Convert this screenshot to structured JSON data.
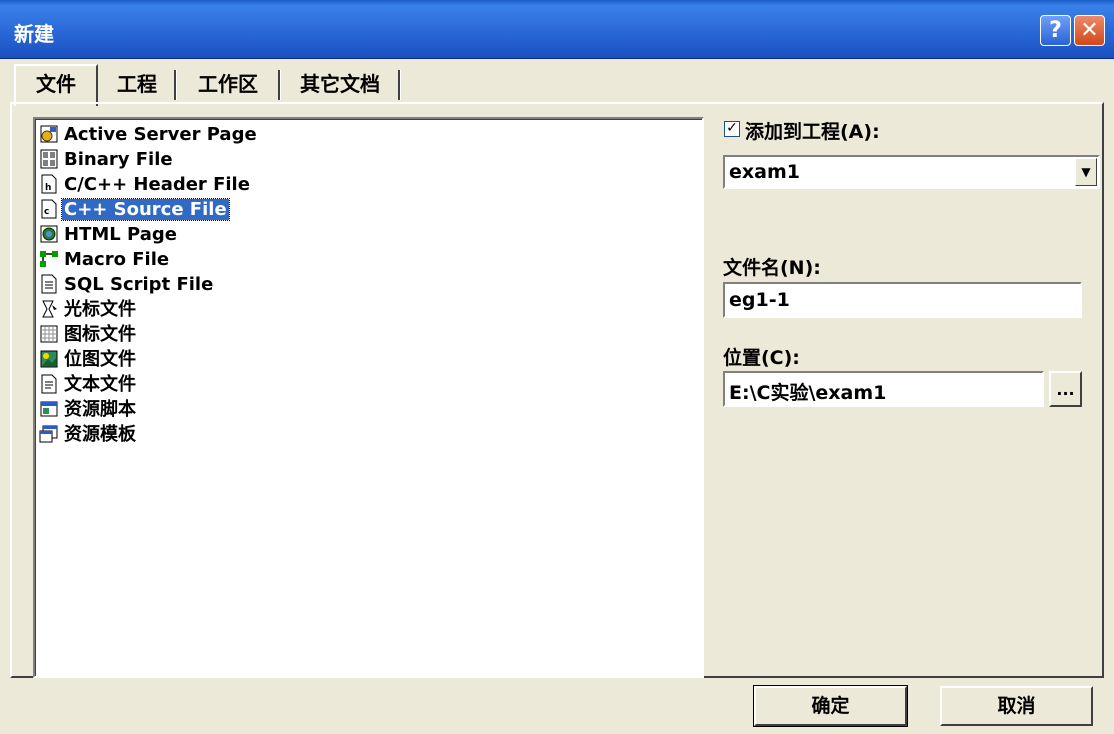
{
  "window": {
    "title": "新建"
  },
  "title_buttons": {
    "help": "?",
    "close": "✕"
  },
  "tabs": [
    {
      "label": "文件",
      "active": true
    },
    {
      "label": "工程",
      "active": false
    },
    {
      "label": "工作区",
      "active": false
    },
    {
      "label": "其它文档",
      "active": false
    }
  ],
  "file_types": [
    {
      "label": "Active Server Page",
      "icon": "asp-page-icon"
    },
    {
      "label": "Binary File",
      "icon": "binary-file-icon"
    },
    {
      "label": "C/C++ Header File",
      "icon": "header-file-icon"
    },
    {
      "label": "C++ Source File",
      "icon": "source-file-icon",
      "selected": true
    },
    {
      "label": "HTML Page",
      "icon": "html-page-icon"
    },
    {
      "label": "Macro File",
      "icon": "macro-file-icon"
    },
    {
      "label": "SQL Script File",
      "icon": "sql-script-icon"
    },
    {
      "label": "光标文件",
      "icon": "cursor-file-icon"
    },
    {
      "label": "图标文件",
      "icon": "icon-file-icon"
    },
    {
      "label": "位图文件",
      "icon": "bitmap-file-icon"
    },
    {
      "label": "文本文件",
      "icon": "text-file-icon"
    },
    {
      "label": "资源脚本",
      "icon": "resource-script-icon"
    },
    {
      "label": "资源模板",
      "icon": "resource-template-icon"
    }
  ],
  "add_to_project": {
    "label": "添加到工程(A):",
    "checked": true,
    "check_mark": "✓",
    "project": "exam1",
    "arrow": "▼"
  },
  "filename": {
    "label": "文件名(N):",
    "value": "eg1-1"
  },
  "location": {
    "label": "位置(C):",
    "value": "E:\\C实验\\exam1",
    "browse": "..."
  },
  "buttons": {
    "ok": "确定",
    "cancel": "取消"
  }
}
